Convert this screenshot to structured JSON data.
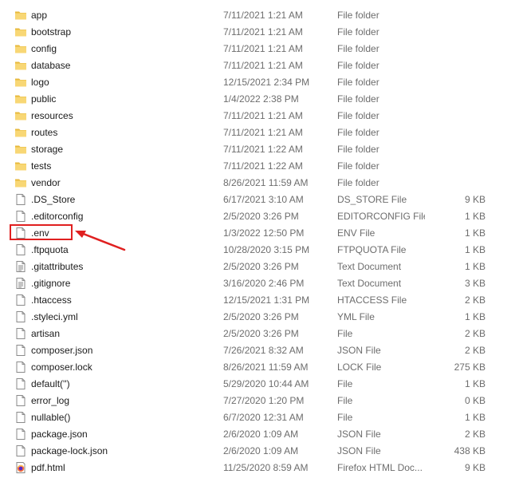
{
  "files": [
    {
      "name": "app",
      "date": "7/11/2021 1:21 AM",
      "type": "File folder",
      "size": "",
      "icon": "folder-icon"
    },
    {
      "name": "bootstrap",
      "date": "7/11/2021 1:21 AM",
      "type": "File folder",
      "size": "",
      "icon": "folder-icon"
    },
    {
      "name": "config",
      "date": "7/11/2021 1:21 AM",
      "type": "File folder",
      "size": "",
      "icon": "folder-icon"
    },
    {
      "name": "database",
      "date": "7/11/2021 1:21 AM",
      "type": "File folder",
      "size": "",
      "icon": "folder-icon"
    },
    {
      "name": "logo",
      "date": "12/15/2021 2:34 PM",
      "type": "File folder",
      "size": "",
      "icon": "folder-icon"
    },
    {
      "name": "public",
      "date": "1/4/2022 2:38 PM",
      "type": "File folder",
      "size": "",
      "icon": "folder-icon"
    },
    {
      "name": "resources",
      "date": "7/11/2021 1:21 AM",
      "type": "File folder",
      "size": "",
      "icon": "folder-icon"
    },
    {
      "name": "routes",
      "date": "7/11/2021 1:21 AM",
      "type": "File folder",
      "size": "",
      "icon": "folder-icon"
    },
    {
      "name": "storage",
      "date": "7/11/2021 1:22 AM",
      "type": "File folder",
      "size": "",
      "icon": "folder-icon"
    },
    {
      "name": "tests",
      "date": "7/11/2021 1:22 AM",
      "type": "File folder",
      "size": "",
      "icon": "folder-icon"
    },
    {
      "name": "vendor",
      "date": "8/26/2021 11:59 AM",
      "type": "File folder",
      "size": "",
      "icon": "folder-icon"
    },
    {
      "name": ".DS_Store",
      "date": "6/17/2021 3:10 AM",
      "type": "DS_STORE File",
      "size": "9 KB",
      "icon": "file-icon"
    },
    {
      "name": ".editorconfig",
      "date": "2/5/2020 3:26 PM",
      "type": "EDITORCONFIG File",
      "size": "1 KB",
      "icon": "file-icon"
    },
    {
      "name": ".env",
      "date": "1/3/2022 12:50 PM",
      "type": "ENV File",
      "size": "1 KB",
      "icon": "file-icon"
    },
    {
      "name": ".ftpquota",
      "date": "10/28/2020 3:15 PM",
      "type": "FTPQUOTA File",
      "size": "1 KB",
      "icon": "file-icon"
    },
    {
      "name": ".gitattributes",
      "date": "2/5/2020 3:26 PM",
      "type": "Text Document",
      "size": "1 KB",
      "icon": "text-document-icon"
    },
    {
      "name": ".gitignore",
      "date": "3/16/2020 2:46 PM",
      "type": "Text Document",
      "size": "3 KB",
      "icon": "text-document-icon"
    },
    {
      "name": ".htaccess",
      "date": "12/15/2021 1:31 PM",
      "type": "HTACCESS File",
      "size": "2 KB",
      "icon": "file-icon"
    },
    {
      "name": ".styleci.yml",
      "date": "2/5/2020 3:26 PM",
      "type": "YML File",
      "size": "1 KB",
      "icon": "file-icon"
    },
    {
      "name": "artisan",
      "date": "2/5/2020 3:26 PM",
      "type": "File",
      "size": "2 KB",
      "icon": "file-icon"
    },
    {
      "name": "composer.json",
      "date": "7/26/2021 8:32 AM",
      "type": "JSON File",
      "size": "2 KB",
      "icon": "file-icon"
    },
    {
      "name": "composer.lock",
      "date": "8/26/2021 11:59 AM",
      "type": "LOCK File",
      "size": "275 KB",
      "icon": "file-icon"
    },
    {
      "name": "default('')",
      "date": "5/29/2020 10:44 AM",
      "type": "File",
      "size": "1 KB",
      "icon": "file-icon"
    },
    {
      "name": "error_log",
      "date": "7/27/2020 1:20 PM",
      "type": "File",
      "size": "0 KB",
      "icon": "file-icon"
    },
    {
      "name": "nullable()",
      "date": "6/7/2020 12:31 AM",
      "type": "File",
      "size": "1 KB",
      "icon": "file-icon"
    },
    {
      "name": "package.json",
      "date": "2/6/2020 1:09 AM",
      "type": "JSON File",
      "size": "2 KB",
      "icon": "file-icon"
    },
    {
      "name": "package-lock.json",
      "date": "2/6/2020 1:09 AM",
      "type": "JSON File",
      "size": "438 KB",
      "icon": "file-icon"
    },
    {
      "name": "pdf.html",
      "date": "11/25/2020 8:59 AM",
      "type": "Firefox HTML Doc...",
      "size": "9 KB",
      "icon": "firefox-html-icon"
    }
  ],
  "annotation": {
    "highlight_color": "#e02020",
    "highlighted_file": ".env"
  },
  "colors": {
    "folder": "#f8d775",
    "folder_dark": "#e7b93c",
    "meta_text": "#6d6d6d"
  }
}
